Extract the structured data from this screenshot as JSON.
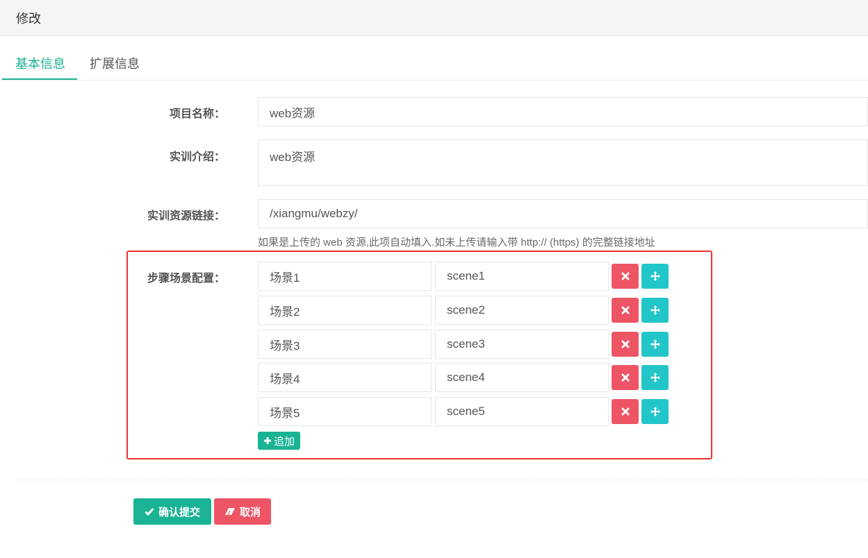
{
  "header": {
    "title": "修改"
  },
  "tabs": [
    {
      "label": "基本信息",
      "active": true
    },
    {
      "label": "扩展信息",
      "active": false
    }
  ],
  "form": {
    "project_name": {
      "label": "项目名称：",
      "value": "web资源"
    },
    "intro": {
      "label": "实训介绍：",
      "value": "web资源"
    },
    "link": {
      "label": "实训资源链接：",
      "value": "/xiangmu/webzy/",
      "help": "如果是上传的 web 资源,此项自动填入.如未上传请输入带 http:// (https) 的完整链接地址"
    },
    "scenes": {
      "label": "步骤场景配置：",
      "rows": [
        {
          "name": "场景1",
          "key": "scene1"
        },
        {
          "name": "场景2",
          "key": "scene2"
        },
        {
          "name": "场景3",
          "key": "scene3"
        },
        {
          "name": "场景4",
          "key": "scene4"
        },
        {
          "name": "场景5",
          "key": "scene5"
        }
      ],
      "add_label": "追加"
    }
  },
  "actions": {
    "submit_label": "确认提交",
    "cancel_label": "取消"
  },
  "icons": {
    "delete": "times-icon",
    "move": "arrows-move-icon",
    "add": "plus-icon",
    "submit": "check-icon",
    "cancel": "eraser-icon"
  },
  "colors": {
    "primary": "#1ab394",
    "danger": "#ed5565",
    "info": "#23c6c8",
    "highlight": "#e8322f"
  }
}
